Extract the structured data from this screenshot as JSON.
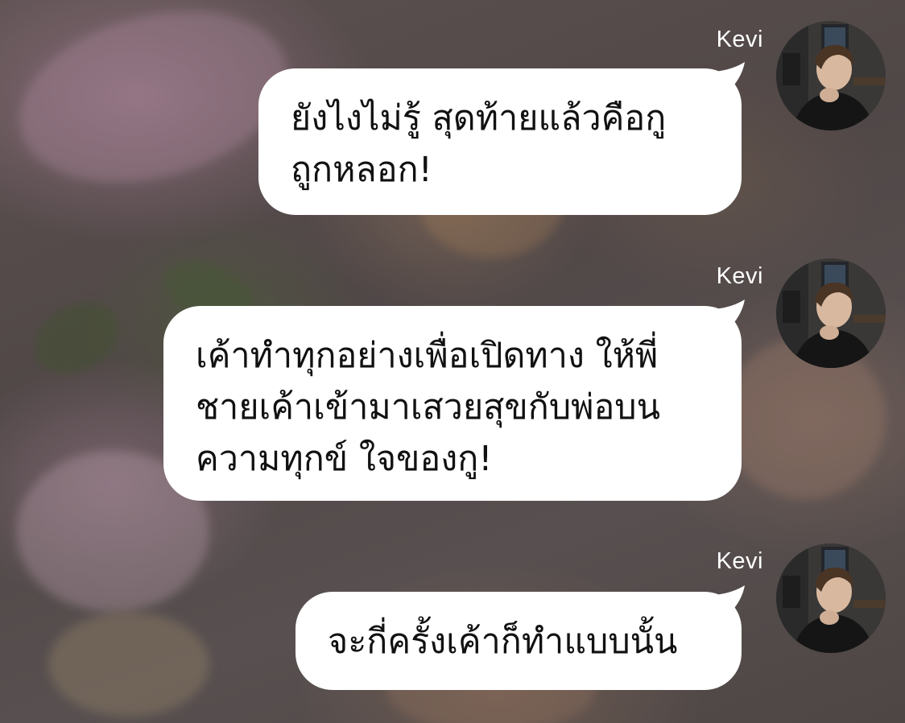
{
  "messages": [
    {
      "sender": "Kevi",
      "lines": [
        "ยังไงไม่รู้ สุดท้ายแล้วคือกู",
        "ถูกหลอก!"
      ]
    },
    {
      "sender": "Kevi",
      "lines": [
        "เค้าทำทุกอย่างเพื่อเปิดทาง ให้พี่",
        "ชายเค้าเข้ามาเสวยสุขกับพ่อบน",
        "ความทุกข์ ใจของกู!"
      ]
    },
    {
      "sender": "Kevi",
      "lines": [
        "จะกี่ครั้งเค้าก็ทำแบบนั้น"
      ]
    }
  ],
  "colors": {
    "bubble": "#ffffff",
    "text": "#111111",
    "name": "#ffffff",
    "background": "#544b4a"
  },
  "icons": {
    "avatar": "profile-photo"
  }
}
